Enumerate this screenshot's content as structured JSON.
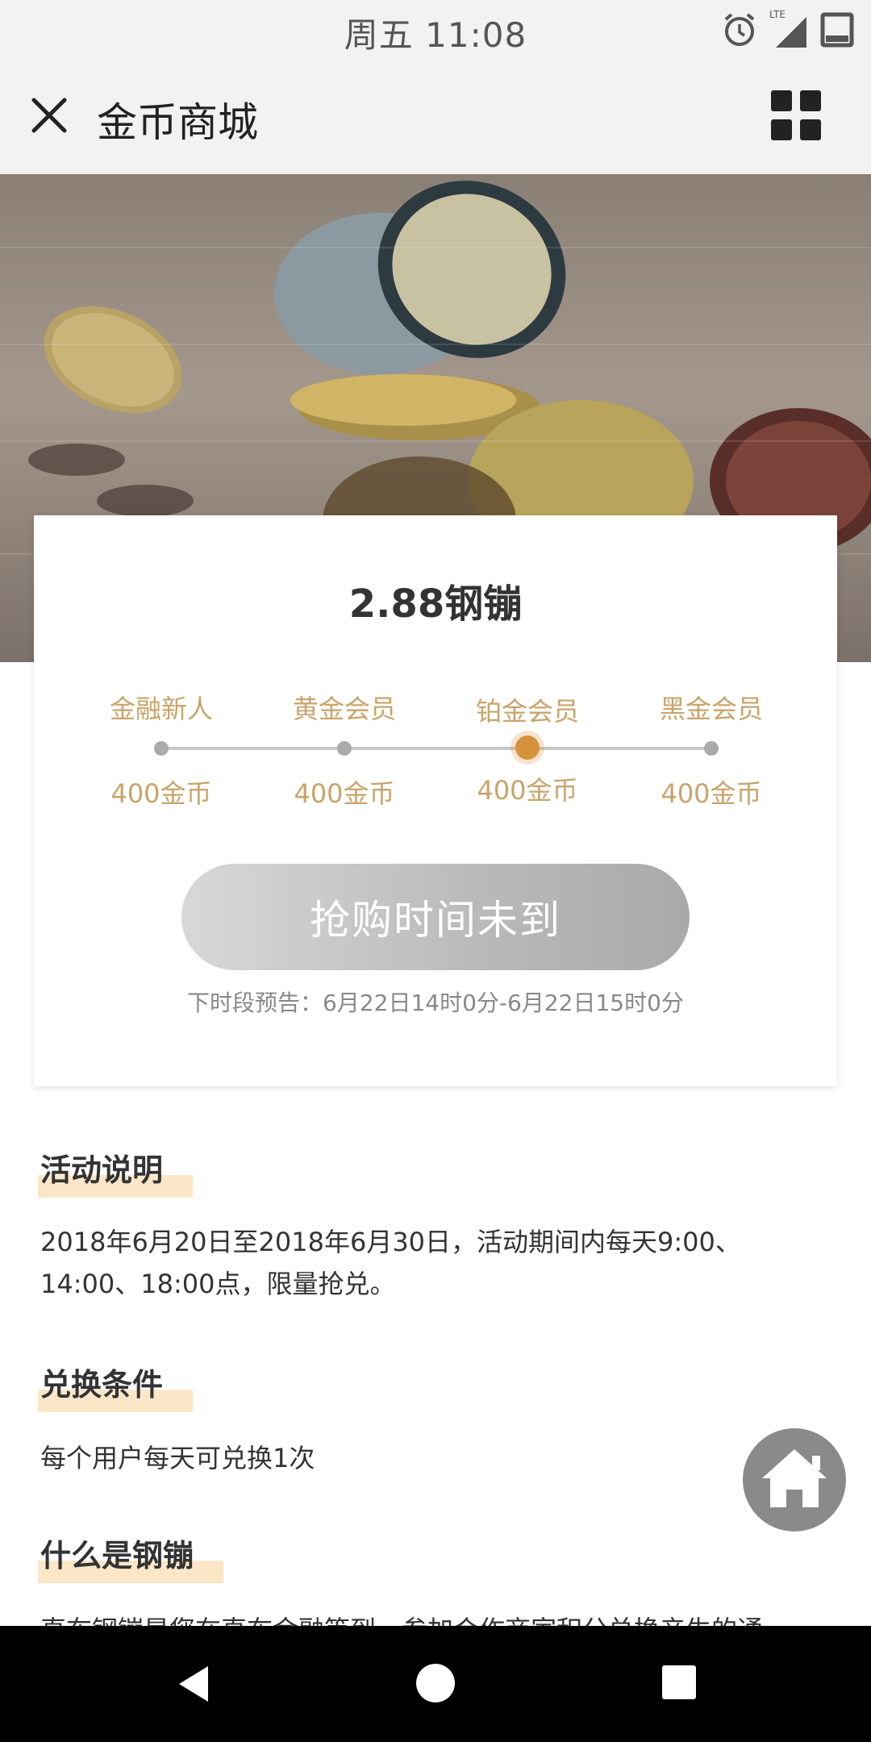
{
  "status_bar": {
    "time": "周五 11:08",
    "network": "LTE"
  },
  "title_bar": {
    "title": "金币商城"
  },
  "card": {
    "price": "2.88钢镚",
    "tiers": [
      {
        "name": "金融新人",
        "coins": "400金币"
      },
      {
        "name": "黄金会员",
        "coins": "400金币"
      },
      {
        "name": "铂金会员",
        "coins": "400金币"
      },
      {
        "name": "黑金会员",
        "coins": "400金币"
      }
    ],
    "active_tier_index": 2,
    "buy_button": "抢购时间未到",
    "next_slot": "下时段预告：6月22日14时0分-6月22日15时0分"
  },
  "sections": {
    "activity": {
      "title": "活动说明",
      "text": "2018年6月20日至2018年6月30日，活动期间内每天9:00、14:00、18:00点，限量抢兑。"
    },
    "exchange": {
      "title": "兑换条件",
      "text": "每个用户每天可兑换1次"
    },
    "whatis": {
      "title": "什么是钢镚",
      "text": "直布钢镚是您在直布金融等到，参加合作商家积分兑换产生的通"
    }
  },
  "colors": {
    "accent": "#c8a46a",
    "active_dot": "#d6913c",
    "highlight": "#fbe7c8",
    "button_gray": "#b9b9b9"
  },
  "icons": [
    "close-icon",
    "grid-icon",
    "home-icon",
    "alarm-icon",
    "signal-icon",
    "battery-icon",
    "back-icon",
    "home-circle-icon",
    "recents-icon"
  ]
}
